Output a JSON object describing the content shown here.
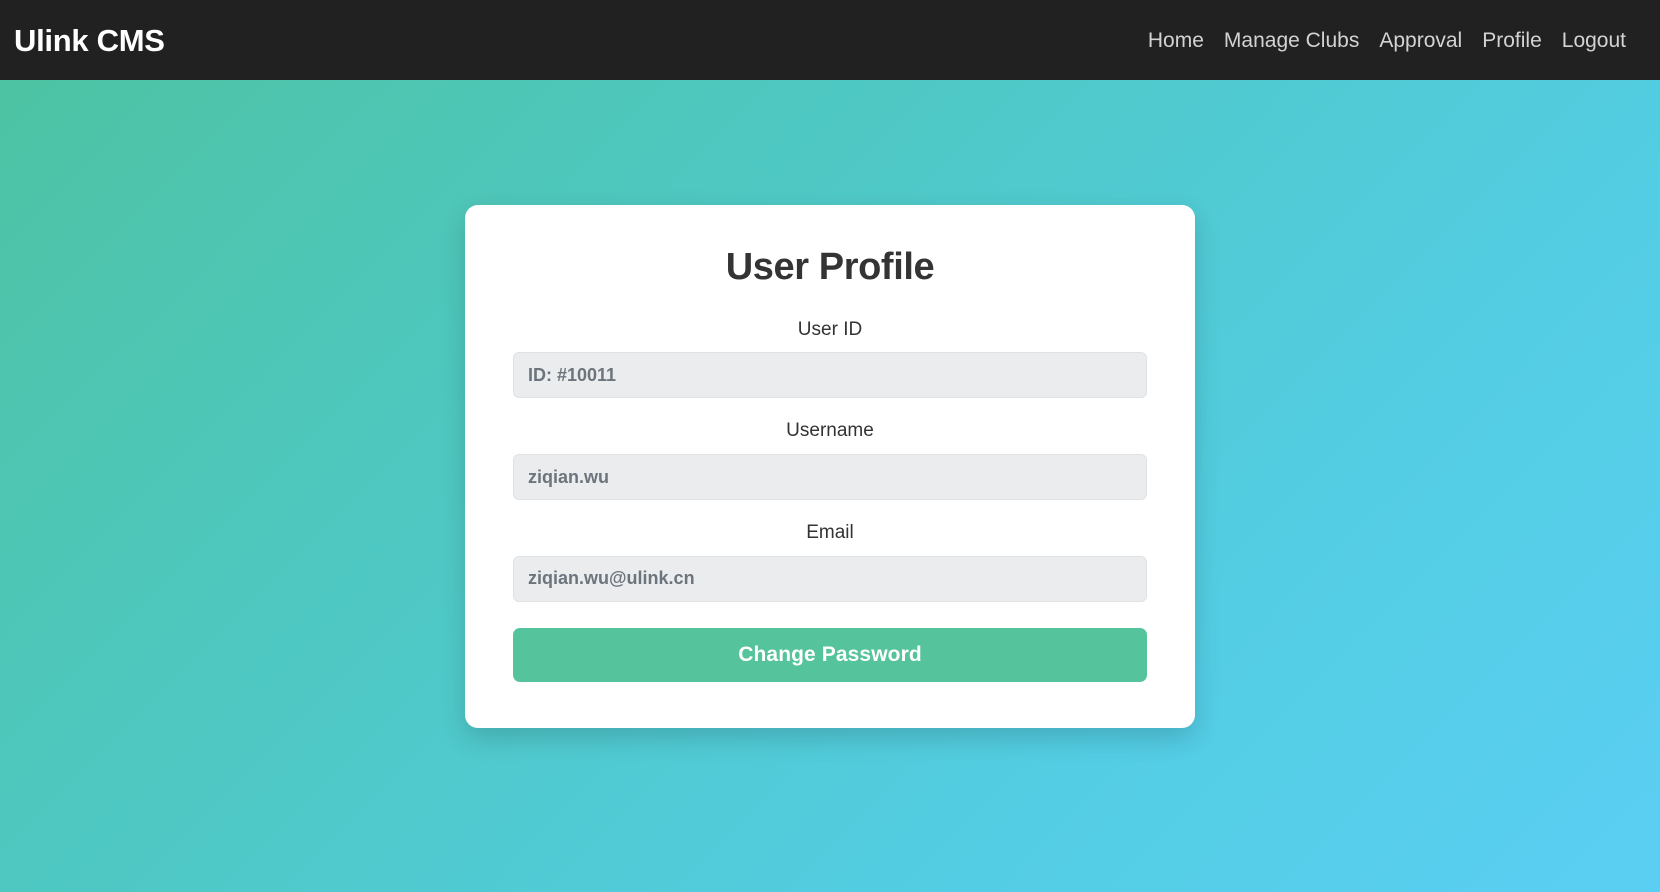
{
  "navbar": {
    "brand": "Ulink CMS",
    "links": [
      {
        "label": "Home",
        "name": "nav-link-home"
      },
      {
        "label": "Manage Clubs",
        "name": "nav-link-manage-clubs"
      },
      {
        "label": "Approval",
        "name": "nav-link-approval"
      },
      {
        "label": "Profile",
        "name": "nav-link-profile"
      },
      {
        "label": "Logout",
        "name": "nav-link-logout"
      }
    ]
  },
  "card": {
    "title": "User Profile",
    "fields": [
      {
        "label": "User ID",
        "value": "ID: #10011"
      },
      {
        "label": "Username",
        "value": "ziqian.wu"
      },
      {
        "label": "Email",
        "value": "ziqian.wu@ulink.cn"
      }
    ],
    "primary_button": "Change Password"
  },
  "colors": {
    "navbar_bg": "#212121",
    "gradient_start": "#4dc3a3",
    "gradient_end": "#5bcff3",
    "accent_green": "#55c39b",
    "card_bg": "#ffffff",
    "input_bg": "#eaecee",
    "input_text": "#6c757d"
  }
}
